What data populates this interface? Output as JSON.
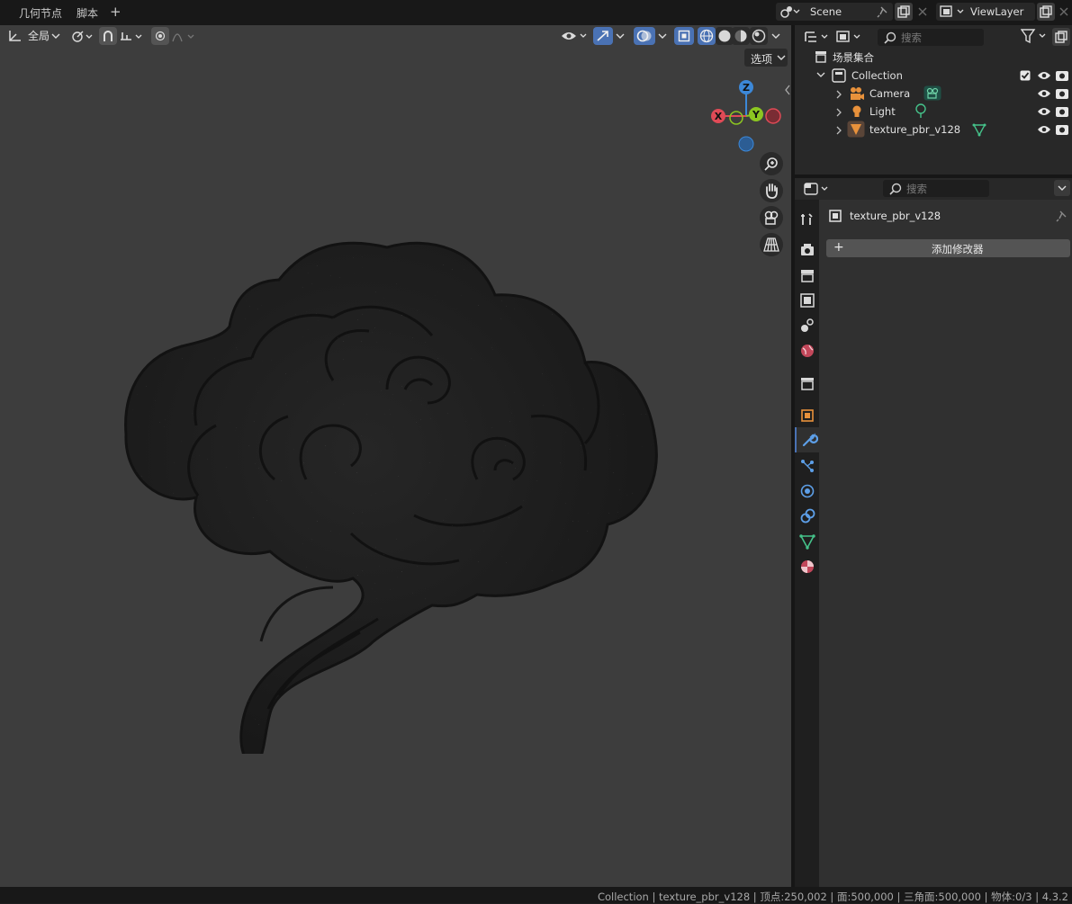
{
  "workspace_tabs": [
    {
      "label": "几何节点"
    },
    {
      "label": "脚本"
    }
  ],
  "add_tab_label": "+",
  "scene": {
    "name": "Scene"
  },
  "view_layer": {
    "name": "ViewLayer"
  },
  "viewport": {
    "orientation_label": "全局",
    "options_label": "选项",
    "gizmo_axes": {
      "x": "X",
      "y": "Y",
      "z": "Z"
    },
    "colors": {
      "x_axis": "#e04a56",
      "y_axis": "#8cc621",
      "z_axis": "#3c88d8",
      "background": "#3d3d3d",
      "mesh": "#1f1f1f"
    }
  },
  "outliner": {
    "search_placeholder": "搜索",
    "root_label": "场景集合",
    "collection_label": "Collection",
    "items": [
      {
        "label": "Camera",
        "icon": "camera-icon",
        "data_icon": "camera-data-icon"
      },
      {
        "label": "Light",
        "icon": "light-icon",
        "data_icon": "light-data-icon"
      },
      {
        "label": "texture_pbr_v128",
        "icon": "mesh-object-icon",
        "data_icon": "mesh-data-icon"
      }
    ]
  },
  "properties": {
    "search_placeholder": "搜索",
    "object_name": "texture_pbr_v128",
    "add_modifier_label": "添加修改器",
    "add_modifier_plus": "+"
  },
  "status_bar": {
    "text": "Collection | texture_pbr_v128 | 顶点:250,002 | 面:500,000 | 三角面:500,000 | 物体:0/3 | 4.3.2"
  }
}
